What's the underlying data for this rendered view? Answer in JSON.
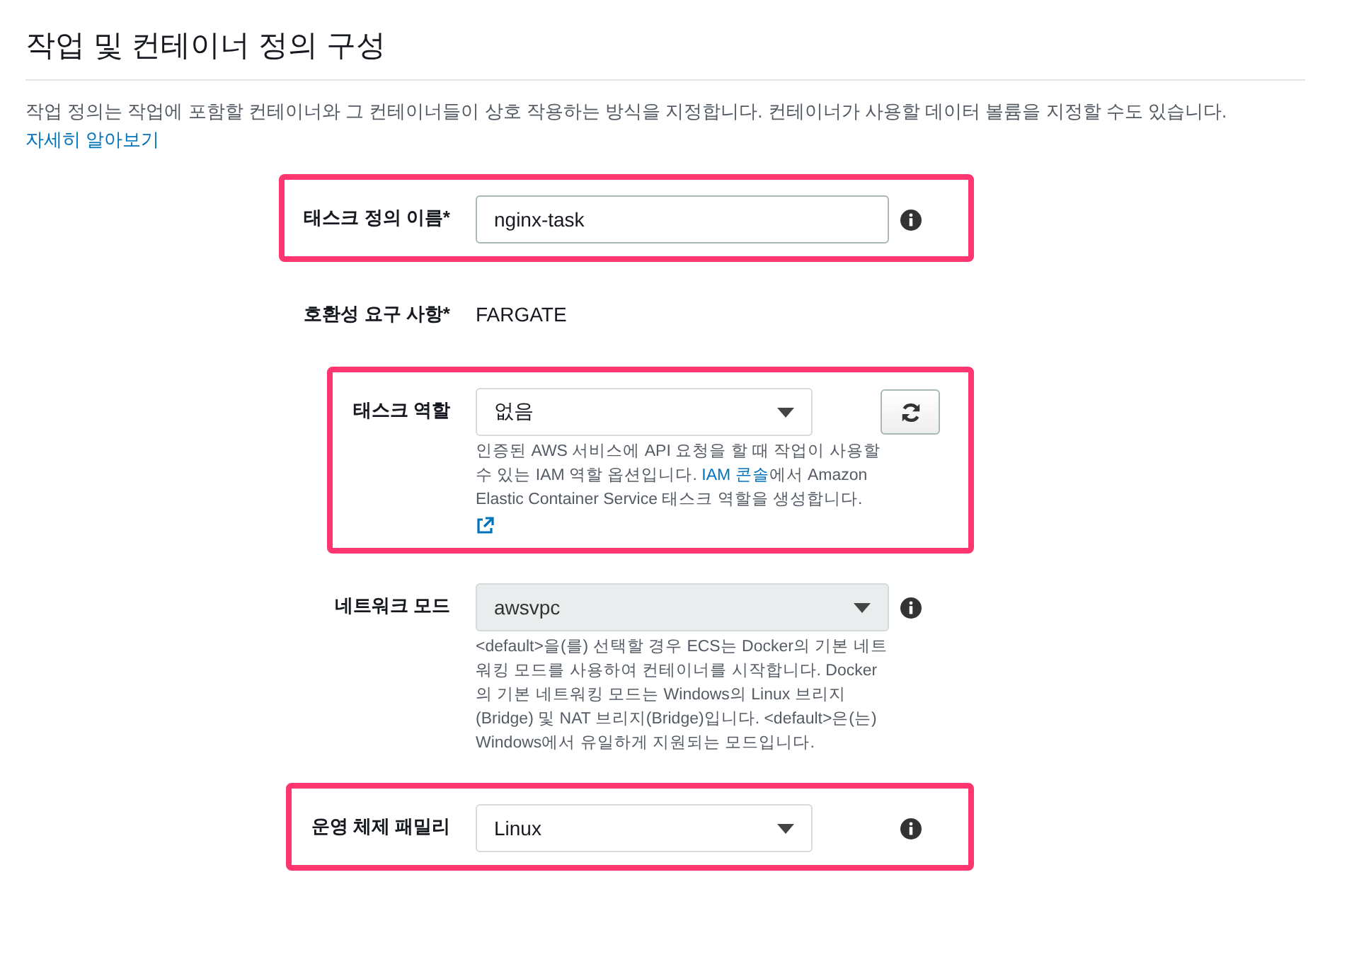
{
  "heading": "작업 및 컨테이너 정의 구성",
  "description": {
    "text": "작업 정의는 작업에 포함할 컨테이너와 그 컨테이너들이 상호 작용하는 방식을 지정합니다. 컨테이너가 사용할 데이터 볼륨을 지정할 수도 있습니다.",
    "link": "자세히 알아보기"
  },
  "fields": [
    {
      "kind": "input",
      "label": "태스크 정의 이름*",
      "value": "nginx-task",
      "info": true,
      "highlighted": true
    },
    {
      "kind": "static",
      "label": "호환성 요구 사항*",
      "value": "FARGATE",
      "highlighted": false
    },
    {
      "kind": "select",
      "label": "태스크 역할",
      "value": "없음",
      "disabled": false,
      "refresh": true,
      "highlighted": true,
      "help": [
        {
          "text": "인증된 AWS 서비스에 API 요청을 할 때 작업이 사용할 수 있는 IAM 역할 옵션입니다. "
        },
        {
          "text": "IAM 콘솔",
          "link": true
        },
        {
          "text": "에서 Amazon Elastic Container Service 태스크 역할을 생성합니다."
        }
      ],
      "external_link": true
    },
    {
      "kind": "select",
      "label": "네트워크 모드",
      "value": "awsvpc",
      "disabled": true,
      "info": true,
      "highlighted": false,
      "help": [
        {
          "text": "<default>을(를) 선택할 경우 ECS는 Docker의 기본 네트워킹 모드를 사용하여 컨테이너를 시작합니다. Docker의 기본 네트워킹 모드는 Windows의 Linux 브리지(Bridge) 및 NAT 브리지(Bridge)입니다. <default>은(는) Windows에서 유일하게 지원되는 모드입니다."
        }
      ]
    },
    {
      "kind": "select",
      "label": "운영 체제 패밀리",
      "value": "Linux",
      "disabled": false,
      "info": true,
      "highlighted": true
    }
  ]
}
